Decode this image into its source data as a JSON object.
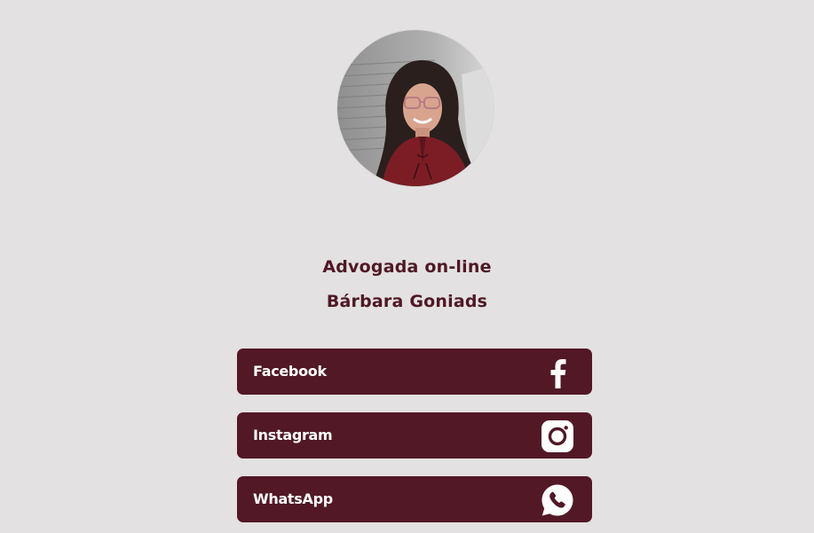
{
  "profile": {
    "line1": "Advogada on-line",
    "line2": "Bárbara Goniads"
  },
  "links": [
    {
      "label": "Facebook",
      "icon": "facebook-icon"
    },
    {
      "label": "Instagram",
      "icon": "instagram-icon"
    },
    {
      "label": "WhatsApp",
      "icon": "whatsapp-icon"
    }
  ],
  "colors": {
    "background": "#e3e1e1",
    "accent": "#521826",
    "text_on_accent": "#ffffff"
  }
}
